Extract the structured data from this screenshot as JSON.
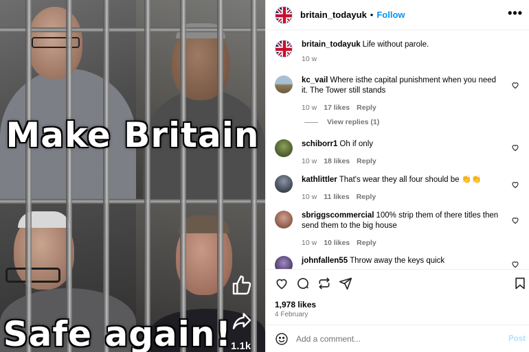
{
  "media": {
    "top_text": "Make Britain",
    "bottom_text": "Safe again!",
    "overlay_count": "1.1k"
  },
  "header": {
    "username": "britain_todayuk",
    "separator": "•",
    "follow_label": "Follow",
    "more_label": "•••",
    "avatar_icon": "union-jack-icon"
  },
  "caption": {
    "username": "britain_todayuk",
    "text": "Life without parole.",
    "time": "10 w"
  },
  "comments": [
    {
      "username": "kc_vail",
      "text": "Where isthe capital punishment when you need it. The Tower still stands",
      "time": "10 w",
      "likes": "17 likes",
      "reply": "Reply",
      "avatar_color": "#8a9db0"
    },
    {
      "username": "schiborr1",
      "text": "Oh if only",
      "time": "10 w",
      "likes": "18 likes",
      "reply": "Reply",
      "avatar_color": "#5b6b3e"
    },
    {
      "username": "kathlittler",
      "text": "That's wear they all four should be 👏👏",
      "time": "10 w",
      "likes": "11 likes",
      "reply": "Reply",
      "avatar_color": "#3d4450"
    },
    {
      "username": "sbriggscommercial",
      "text": "100% strip them of there titles then send them to the big house",
      "time": "10 w",
      "likes": "10 likes",
      "reply": "Reply",
      "avatar_color": "#8b5a4a"
    },
    {
      "username": "johnfallen55",
      "text": "Throw away the keys quick",
      "time": "",
      "likes": "",
      "reply": "",
      "avatar_color": "#4a3a6a"
    }
  ],
  "view_replies": "View replies (1)",
  "actions": {
    "likes": "1,978 likes",
    "date": "4 February"
  },
  "comment_bar": {
    "placeholder": "Add a comment...",
    "post_label": "Post"
  }
}
